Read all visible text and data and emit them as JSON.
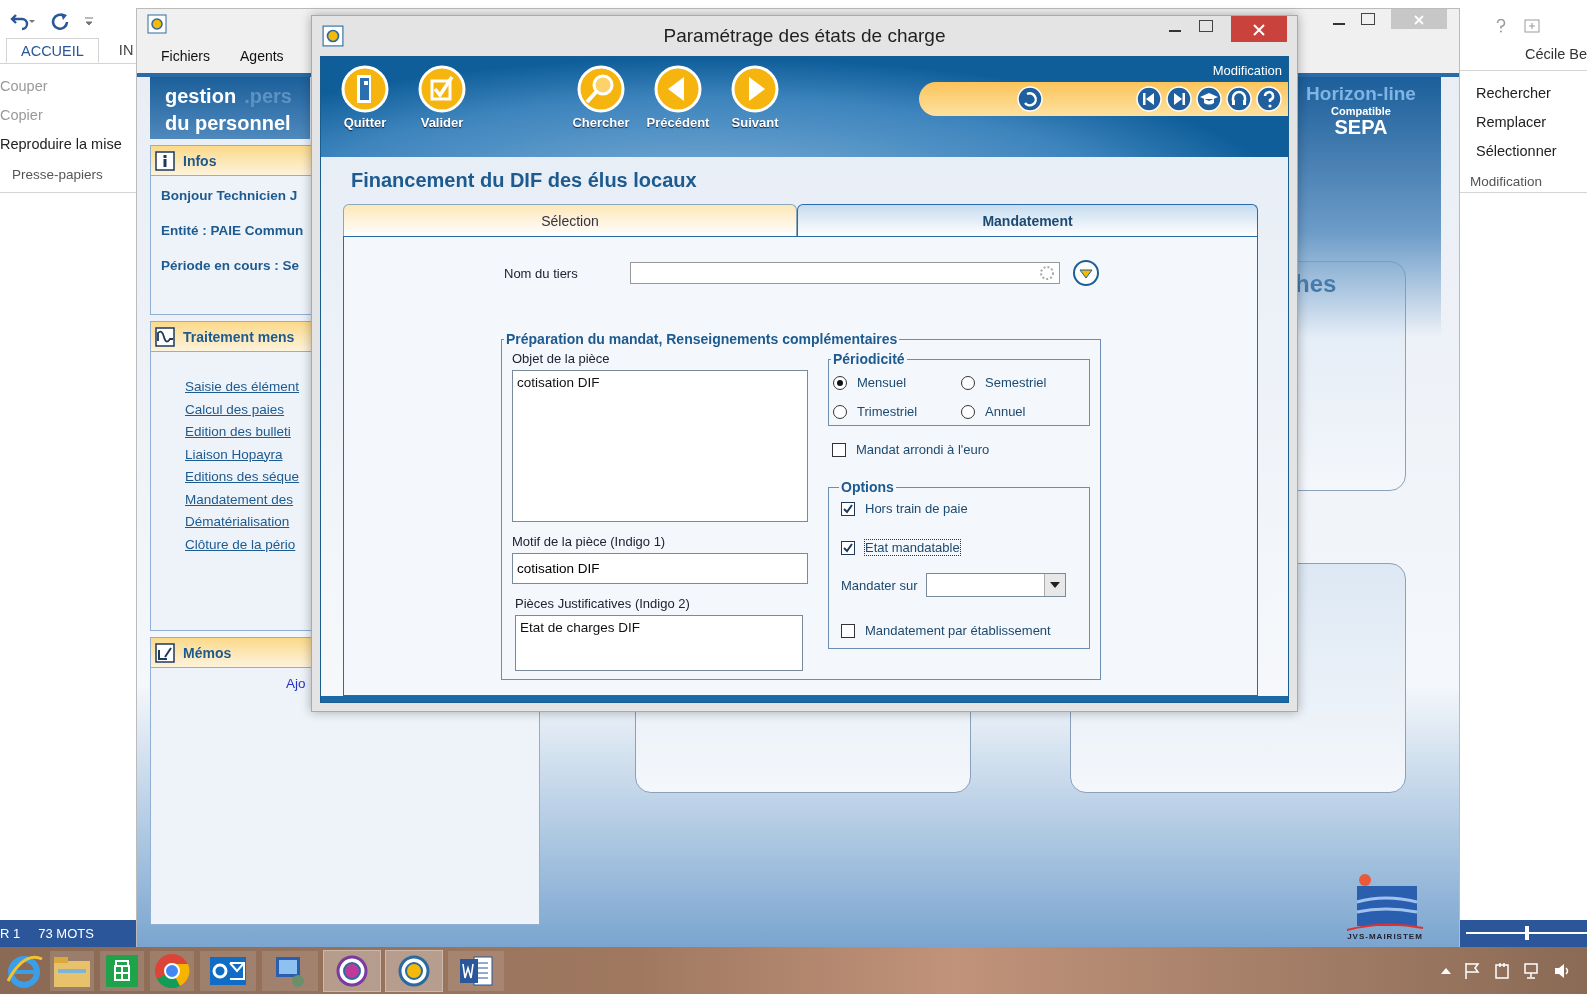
{
  "word": {
    "tabs": [
      {
        "label": "ACCUEIL",
        "selected": true
      },
      {
        "label": "IN",
        "selected": false
      }
    ],
    "clipboard": {
      "items": [
        {
          "label": "Couper",
          "disabled": true
        },
        {
          "label": "Copier",
          "disabled": true
        },
        {
          "label": "Reproduire la mise",
          "disabled": false
        }
      ],
      "group_label": "Presse-papiers"
    },
    "user": "Cécile Be",
    "editing": {
      "items": [
        {
          "label": "Rechercher"
        },
        {
          "label": "Remplacer"
        },
        {
          "label": "Sélectionner"
        }
      ],
      "group_label": "Modification"
    },
    "status_bar": [
      "R 1",
      "73 MOTS"
    ],
    "zoom_slider": {
      "level": 0.5
    }
  },
  "app": {
    "menu": [
      "Fichiers",
      "Agents"
    ],
    "brand": {
      "line1": "gestion",
      "ghost": ".pers",
      "line2": "du personnel"
    },
    "infos": {
      "title": "Infos",
      "lines": [
        "Bonjour Technicien J",
        "Entité : PAIE Commun",
        "Période en cours : Se"
      ]
    },
    "traitement": {
      "title": "Traitement mens",
      "links": [
        "Saisie des élément",
        "Calcul des paies",
        "Edition des bulleti",
        "Liaison Hopayra",
        "Editions des séque",
        "Mandatement des",
        "Dématérialisation",
        "Clôture de la pério"
      ]
    },
    "memos": {
      "title": "Mémos",
      "link": "Ajo"
    },
    "card_title": "hes",
    "sepa_logo": {
      "name": "Horizon-line",
      "tagline": "Compatible",
      "badge": "SEPA"
    },
    "maker_logo": "JVS-MAIRISTEM"
  },
  "dialog": {
    "title": "Paramétrage des états de charge",
    "toolbar": [
      {
        "label": "Quitter",
        "kind": "door"
      },
      {
        "label": "Valider",
        "kind": "check"
      },
      {
        "label": "Chercher",
        "kind": "search"
      },
      {
        "label": "Précédent",
        "kind": "left"
      },
      {
        "label": "Suivant",
        "kind": "right"
      }
    ],
    "mode": "Modification",
    "heading": "Financement du DIF des élus locaux",
    "tabs": [
      {
        "label": "Sélection",
        "selected": false
      },
      {
        "label": "Mandatement",
        "selected": true
      }
    ],
    "tiers": {
      "label": "Nom du tiers"
    },
    "group": {
      "legend": "Préparation du mandat, Renseignements complémentaires",
      "objet": {
        "label": "Objet de la pièce",
        "value": "cotisation DIF"
      },
      "motif": {
        "label": "Motif de la pièce (Indigo 1)",
        "value": "cotisation DIF"
      },
      "pieces": {
        "label": "Pièces Justificatives (Indigo 2)",
        "value": "Etat de charges DIF"
      },
      "periodicite": {
        "legend": "Périodicité",
        "options": [
          {
            "label": "Mensuel",
            "selected": true
          },
          {
            "label": "Semestriel",
            "selected": false
          },
          {
            "label": "Trimestriel",
            "selected": false
          },
          {
            "label": "Annuel",
            "selected": false
          }
        ]
      },
      "arrondi": {
        "label": "Mandat arrondi à l'euro",
        "checked": false
      },
      "options": {
        "legend": "Options",
        "hors_train": {
          "label": "Hors train de paie",
          "checked": true
        },
        "etat_mandatable": {
          "label": "Etat mandatable",
          "checked": true
        },
        "mandater_sur": {
          "label": "Mandater sur"
        },
        "par_etablissement": {
          "label": "Mandatement par établissement",
          "checked": false
        }
      }
    }
  }
}
